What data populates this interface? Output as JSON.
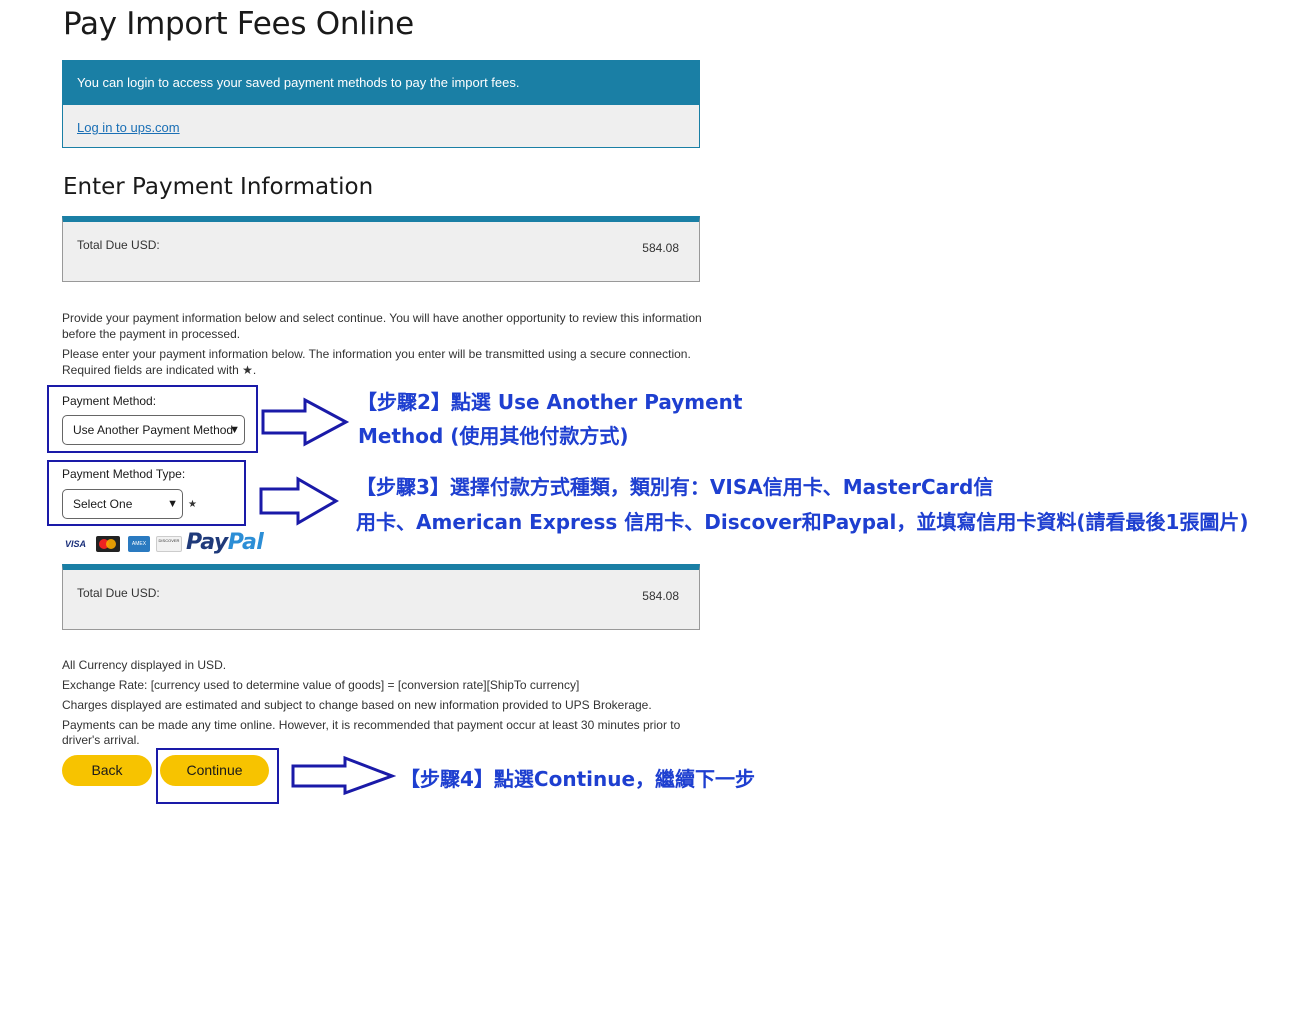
{
  "page": {
    "title": "Pay Import Fees Online"
  },
  "login": {
    "message": "You can login to access your saved payment methods to pay the import fees.",
    "link_text": "Log in to ups.com"
  },
  "payment": {
    "heading": "Enter Payment Information",
    "total_label": "Total Due USD:",
    "total_value": "584.08",
    "instructions_1": "Provide your payment information below and select continue. You will have another opportunity to review this information before the payment in processed.",
    "instructions_2": "Please enter your payment information below. The information you enter will be transmitted using a secure connection. Required fields are indicated with ★.",
    "method_label": "Payment Method:",
    "method_value": "Use Another Payment Method",
    "type_label": "Payment Method Type:",
    "type_value": "Select One",
    "required_mark": "★",
    "card_logos": [
      "VISA",
      "MasterCard",
      "AMEX",
      "DISCOVER"
    ],
    "paypal_text": "PayPal"
  },
  "footer_total": {
    "label": "Total Due USD:",
    "value": "584.08"
  },
  "notes": {
    "currency": "All Currency displayed in USD.",
    "exchange": "Exchange Rate: [currency used to determine value of goods] = [conversion rate][ShipTo currency]",
    "charges": "Charges displayed are estimated and subject to change based on new information provided to UPS Brokerage.",
    "payments": "Payments can be made any time online. However, it is recommended that payment occur at least 30 minutes prior to driver's arrival."
  },
  "buttons": {
    "back": "Back",
    "continue": "Continue"
  },
  "annotations": {
    "step2_line1": "【步驟2】點選 Use Another Payment",
    "step2_line2": "Method (使用其他付款方式)",
    "step3_line1": "【步驟3】選擇付款方式種類，類別有：VISA信用卡、MasterCard信",
    "step3_line2": "用卡、American Express 信用卡、Discover和Paypal，並填寫信用卡資料(請看最後1張圖片)",
    "step4": "【步驟4】點選Continue，繼續下一步"
  },
  "colors": {
    "ups_blue": "#1a7fa5",
    "button_yellow": "#f7c300",
    "annotation_blue": "#1e3fd0",
    "frame_blue": "#1a1aa8"
  }
}
